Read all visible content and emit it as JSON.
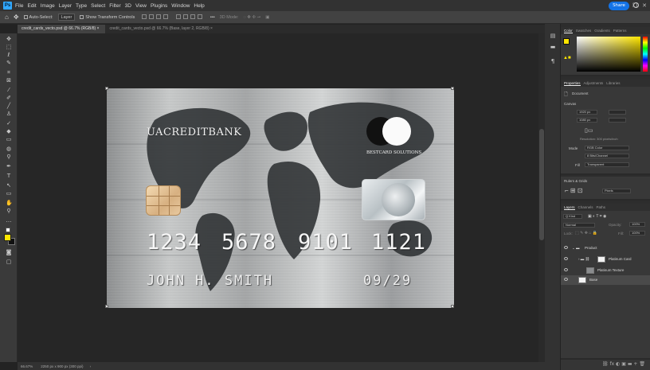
{
  "menu": {
    "logo": "Ps",
    "items": [
      "File",
      "Edit",
      "Image",
      "Layer",
      "Type",
      "Select",
      "Filter",
      "3D",
      "View",
      "Plugins",
      "Window",
      "Help"
    ]
  },
  "options": {
    "auto_select_label": "Auto-Select:",
    "auto_select_value": "Layer",
    "show_transform": "Show Transform Controls",
    "mode_3d": "3D Mode:",
    "more": "•••",
    "share_label": "Share"
  },
  "tabs": [
    {
      "label": "credit_cards_vecto.psd @ 66.7% (RGB/8) ×"
    },
    {
      "label": "credit_cards_vecto.psd @ 66.7% (Base, layer 2, RGB/8) ×"
    }
  ],
  "card": {
    "bank_name": "UACREDITBANK",
    "brand_text": "BESTCARD SOLUTIONS",
    "num1": "1234",
    "num2": "5678",
    "num3": "9101",
    "num4": "1121",
    "holder": "JOHN H. SMITH",
    "expiry": "09/29"
  },
  "panels": {
    "color_tabs": [
      "Color",
      "Swatches",
      "Gradients",
      "Patterns"
    ],
    "props_tabs": [
      "Properties",
      "Adjustments",
      "Libraries"
    ],
    "doc_label": "Document",
    "canvas_section": "Canvas",
    "width_field": "1920 px",
    "height_field": "1080 px",
    "resolution": "Resolution: 300 pixels/inch",
    "mode_label": "Mode",
    "mode_value": "RGB Color",
    "bit_value": "8 Bits/Channel",
    "fill_label": "Fill",
    "fill_value": "Transparent",
    "rulers_section": "Rulers & Grids",
    "units_value": "Pixels",
    "layers_tabs": [
      "Layers",
      "Channels",
      "Paths"
    ],
    "kind_label": "Q Kind",
    "blend_label": "Normal",
    "opacity_label": "Opacity:",
    "opacity_value": "100%",
    "lock_label": "Lock:",
    "fill2_label": "Fill:",
    "fill2_value": "100%"
  },
  "layers": [
    {
      "name": "Product"
    },
    {
      "name": "Platinum Card"
    },
    {
      "name": "Platinum Texture"
    },
    {
      "name": "Base"
    }
  ],
  "status": {
    "zoom": "66.67%",
    "dims": "2250 px x 900 px (300 ppi)"
  },
  "colors": {
    "accent_blue": "#31a8ff",
    "share_blue": "#1473e6",
    "fg_swatch": "#ffe600",
    "bg_dark": "#262626"
  }
}
